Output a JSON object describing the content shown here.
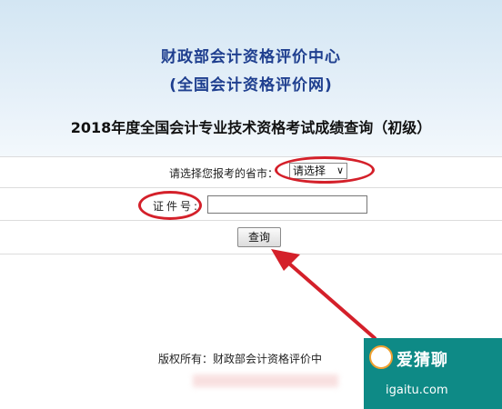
{
  "header": {
    "org_name": "财政部会计资格评价中心",
    "org_sub": "(全国会计资格评价网)",
    "page_title": "2018年度全国会计专业技术资格考试成绩查询（初级）"
  },
  "form": {
    "province_label": "请选择您报考的省市：",
    "province_select_value": "请选择",
    "id_label": "证件号:",
    "id_input_value": "",
    "query_button": "查询"
  },
  "footer": {
    "copyright": "版权所有：财政部会计资格评价中"
  },
  "watermark": {
    "name": "爱猜聊",
    "url": "igaitu.com"
  },
  "colors": {
    "header_text": "#1f3f8f",
    "annotation_red": "#d4202a",
    "watermark_bg": "#0e8a86"
  }
}
